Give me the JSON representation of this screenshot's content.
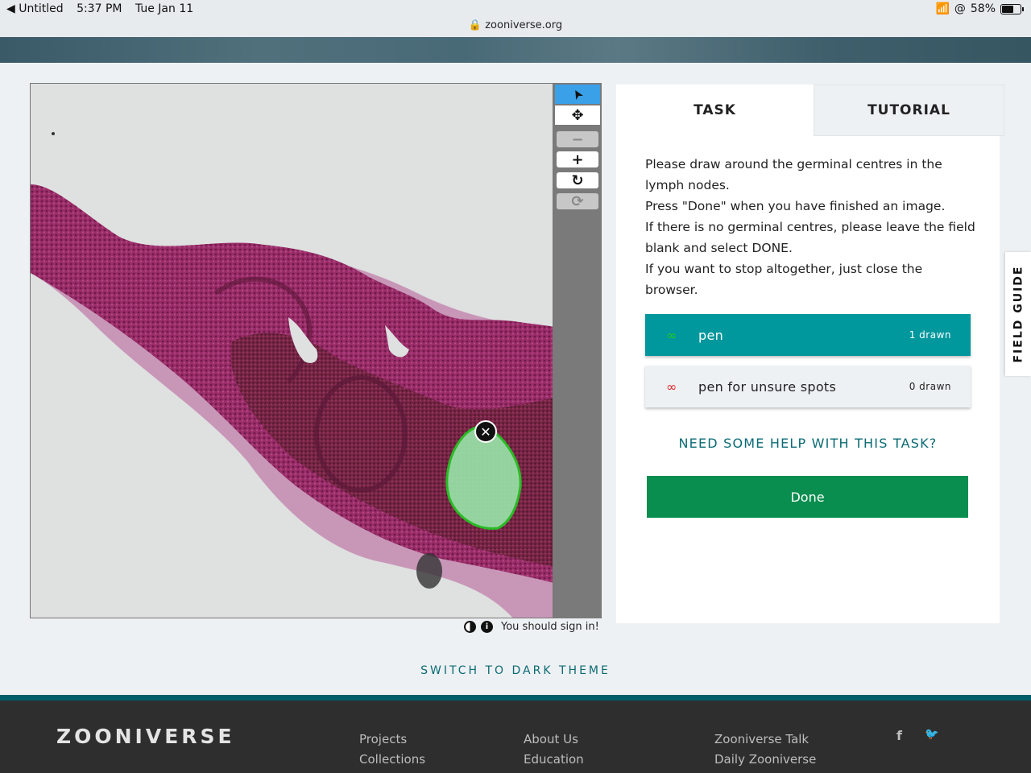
{
  "status_bar": {
    "back_app": "◀ Untitled",
    "time": "5:37 PM",
    "date": "Tue Jan 11",
    "url": "zooniverse.org",
    "battery": "58%",
    "battery_level": 0.58
  },
  "viewer": {
    "toolbar": [
      {
        "name": "annotate-tool-button",
        "icon": "cursor-arrow-icon",
        "glyph": "➤",
        "active": true
      },
      {
        "name": "pan-tool-button",
        "icon": "move-arrows-icon",
        "glyph": "✥"
      },
      {
        "name": "zoom-out-button",
        "icon": "minus-icon",
        "glyph": "−",
        "disabled": true
      },
      {
        "name": "zoom-in-button",
        "icon": "plus-icon",
        "glyph": "+"
      },
      {
        "name": "rotate-button",
        "icon": "rotate-icon",
        "glyph": "↻"
      },
      {
        "name": "reset-button",
        "icon": "reset-icon",
        "glyph": "⟳",
        "disabled": true
      }
    ],
    "sign_in_message": "You should sign in!",
    "annotation_color": "#22cc22"
  },
  "task": {
    "tabs": [
      "TASK",
      "TUTORIAL"
    ],
    "instructions": [
      "Please draw around the germinal centres in the lymph nodes.",
      "Press \"Done\" when you have finished an image.",
      "If there is no germinal centres, please leave the field blank and select DONE.",
      "If you want to stop altogether, just close the browser."
    ],
    "tools": [
      {
        "label": "pen",
        "count": "1 drawn",
        "icon": "freehand-pen-icon",
        "color": "#22cc22"
      },
      {
        "label": "pen for unsure spots",
        "count": "0 drawn",
        "icon": "freehand-pen-icon",
        "color": "#e02020"
      }
    ],
    "help_link": "NEED SOME HELP WITH THIS TASK?",
    "done_label": "Done"
  },
  "field_guide": "FIELD GUIDE",
  "theme_toggle": "SWITCH TO DARK THEME",
  "footer": {
    "logo": "ZOONIVERSE",
    "columns": [
      [
        "Projects",
        "Collections"
      ],
      [
        "About Us",
        "Education"
      ],
      [
        "Zooniverse Talk",
        "Daily Zooniverse"
      ]
    ],
    "social": [
      "f",
      "🐦"
    ]
  },
  "colors": {
    "teal": "#00979d",
    "done_green": "#098e4f",
    "link_teal": "#0a6b74",
    "footer_bg": "#2e2e2e"
  }
}
